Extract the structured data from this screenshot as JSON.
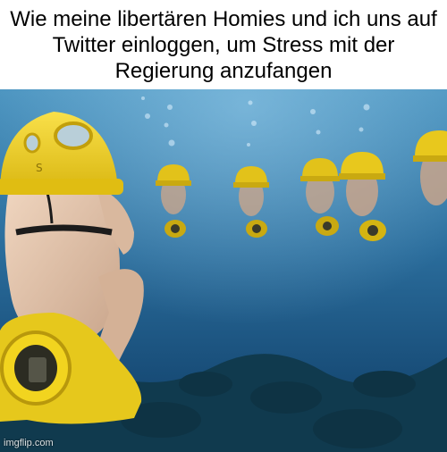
{
  "meme": {
    "caption": "Wie meine libertären Homies und ich uns auf Twitter einloggen, um Stress mit der Regierung anzufangen",
    "watermark": "imgflip.com"
  },
  "colors": {
    "caption_background": "#ffffff",
    "caption_text": "#000000",
    "water_light": "#3f86b6",
    "water_deep": "#0d3a63",
    "seafloor": "#103a4e",
    "helmet_yellow": "#f3d11b",
    "skin": "#e8c8ad"
  }
}
